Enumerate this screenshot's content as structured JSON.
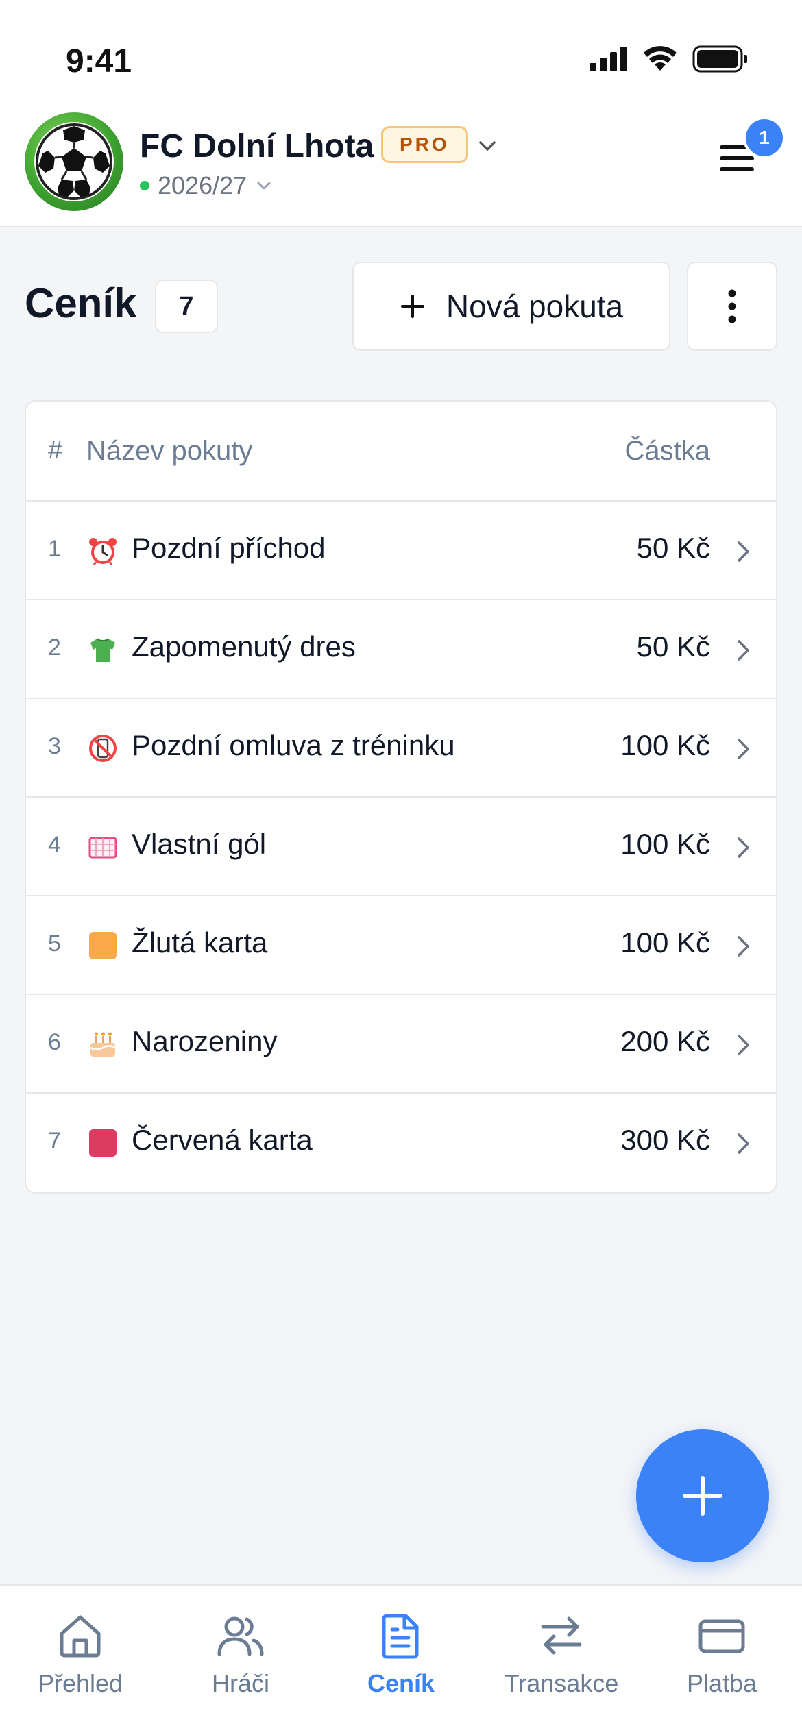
{
  "status_bar": {
    "time": "9:41"
  },
  "header": {
    "team_name": "FC Dolní Lhota",
    "plan_badge": "PRO",
    "season": "2026/27",
    "notification_count": "1"
  },
  "page": {
    "title": "Ceník",
    "count": "7",
    "new_button_label": "Nová pokuta"
  },
  "table": {
    "columns": {
      "number": "#",
      "name": "Název pokuty",
      "amount": "Částka"
    },
    "rows": [
      {
        "num": "1",
        "icon": "alarm-clock-icon",
        "name": "Pozdní příchod",
        "amount": "50 Kč"
      },
      {
        "num": "2",
        "icon": "jersey-icon",
        "name": "Zapomenutý dres",
        "amount": "50 Kč"
      },
      {
        "num": "3",
        "icon": "no-phone-icon",
        "name": "Pozdní omluva z tréninku",
        "amount": "100 Kč"
      },
      {
        "num": "4",
        "icon": "goal-net-icon",
        "name": "Vlastní gól",
        "amount": "100 Kč"
      },
      {
        "num": "5",
        "icon": "yellow-card-icon",
        "name": "Žlutá karta",
        "amount": "100 Kč"
      },
      {
        "num": "6",
        "icon": "birthday-cake-icon",
        "name": "Narozeniny",
        "amount": "200 Kč"
      },
      {
        "num": "7",
        "icon": "red-card-icon",
        "name": "Červená karta",
        "amount": "300 Kč"
      }
    ]
  },
  "bottom_nav": {
    "items": [
      {
        "label": "Přehled",
        "icon": "home-icon"
      },
      {
        "label": "Hráči",
        "icon": "users-icon"
      },
      {
        "label": "Ceník",
        "icon": "document-icon",
        "active": true
      },
      {
        "label": "Transakce",
        "icon": "transfer-icon"
      },
      {
        "label": "Platba",
        "icon": "card-icon"
      }
    ]
  },
  "colors": {
    "accent": "#3b82f6",
    "pro_badge_bg": "#fff5e0",
    "pro_badge_text": "#b45309",
    "season_dot": "#22c55e"
  }
}
